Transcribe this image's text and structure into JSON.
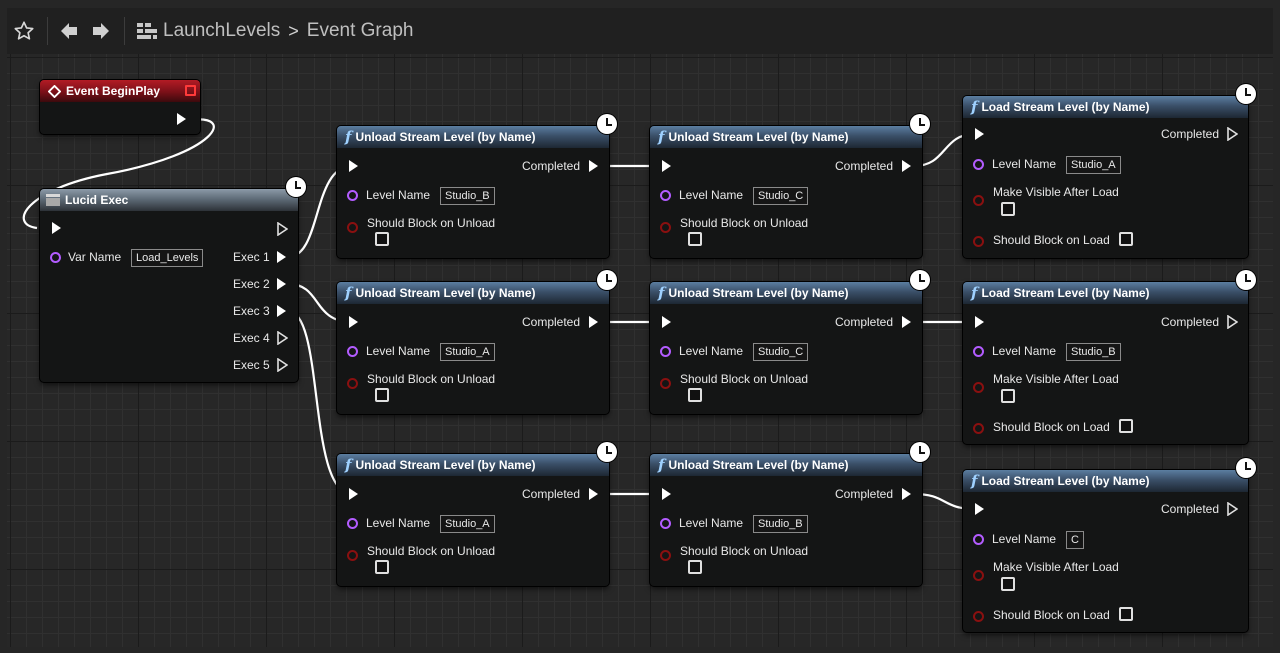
{
  "toolbar": {
    "favorite_icon": "star-outline-icon",
    "back_icon": "arrow-left-icon",
    "forward_icon": "arrow-right-icon",
    "blueprint_icon": "blueprint-grid-icon",
    "breadcrumb_root": "LaunchLevels",
    "breadcrumb_separator": ">",
    "breadcrumb_current": "Event Graph"
  },
  "nodes": {
    "begin_play": {
      "title": "Event BeginPlay"
    },
    "lucid_exec": {
      "title": "Lucid Exec",
      "var_name_label": "Var Name",
      "var_name_value": "Load_Levels",
      "outputs": [
        "Exec 1",
        "Exec 2",
        "Exec 3",
        "Exec 4",
        "Exec 5"
      ]
    },
    "unload_1a": {
      "title": "Unload Stream Level (by Name)",
      "completed": "Completed",
      "level_label": "Level Name",
      "level_value": "Studio_B",
      "block_label": "Should Block on Unload"
    },
    "unload_1b": {
      "title": "Unload Stream Level (by Name)",
      "completed": "Completed",
      "level_label": "Level Name",
      "level_value": "Studio_C",
      "block_label": "Should Block on Unload"
    },
    "load_1": {
      "title": "Load Stream Level (by Name)",
      "completed": "Completed",
      "level_label": "Level Name",
      "level_value": "Studio_A",
      "visible_label": "Make Visible After Load",
      "block_label": "Should Block on Load"
    },
    "unload_2a": {
      "title": "Unload Stream Level (by Name)",
      "completed": "Completed",
      "level_label": "Level Name",
      "level_value": "Studio_A",
      "block_label": "Should Block on Unload"
    },
    "unload_2b": {
      "title": "Unload Stream Level (by Name)",
      "completed": "Completed",
      "level_label": "Level Name",
      "level_value": "Studio_C",
      "block_label": "Should Block on Unload"
    },
    "load_2": {
      "title": "Load Stream Level (by Name)",
      "completed": "Completed",
      "level_label": "Level Name",
      "level_value": "Studio_B",
      "visible_label": "Make Visible After Load",
      "block_label": "Should Block on Load"
    },
    "unload_3a": {
      "title": "Unload Stream Level (by Name)",
      "completed": "Completed",
      "level_label": "Level Name",
      "level_value": "Studio_A",
      "block_label": "Should Block on Unload"
    },
    "unload_3b": {
      "title": "Unload Stream Level (by Name)",
      "completed": "Completed",
      "level_label": "Level Name",
      "level_value": "Studio_B",
      "block_label": "Should Block on Unload"
    },
    "load_3": {
      "title": "Load Stream Level (by Name)",
      "completed": "Completed",
      "level_label": "Level Name",
      "level_value": "C",
      "visible_label": "Make Visible After Load",
      "block_label": "Should Block on Load"
    }
  },
  "colors": {
    "graph_bg": "#272727",
    "func_header": "#3a4f68",
    "event_header": "#9b1720",
    "string_pin": "#b35cff",
    "bool_pin": "#8a1010",
    "exec_wire": "#ffffff"
  }
}
